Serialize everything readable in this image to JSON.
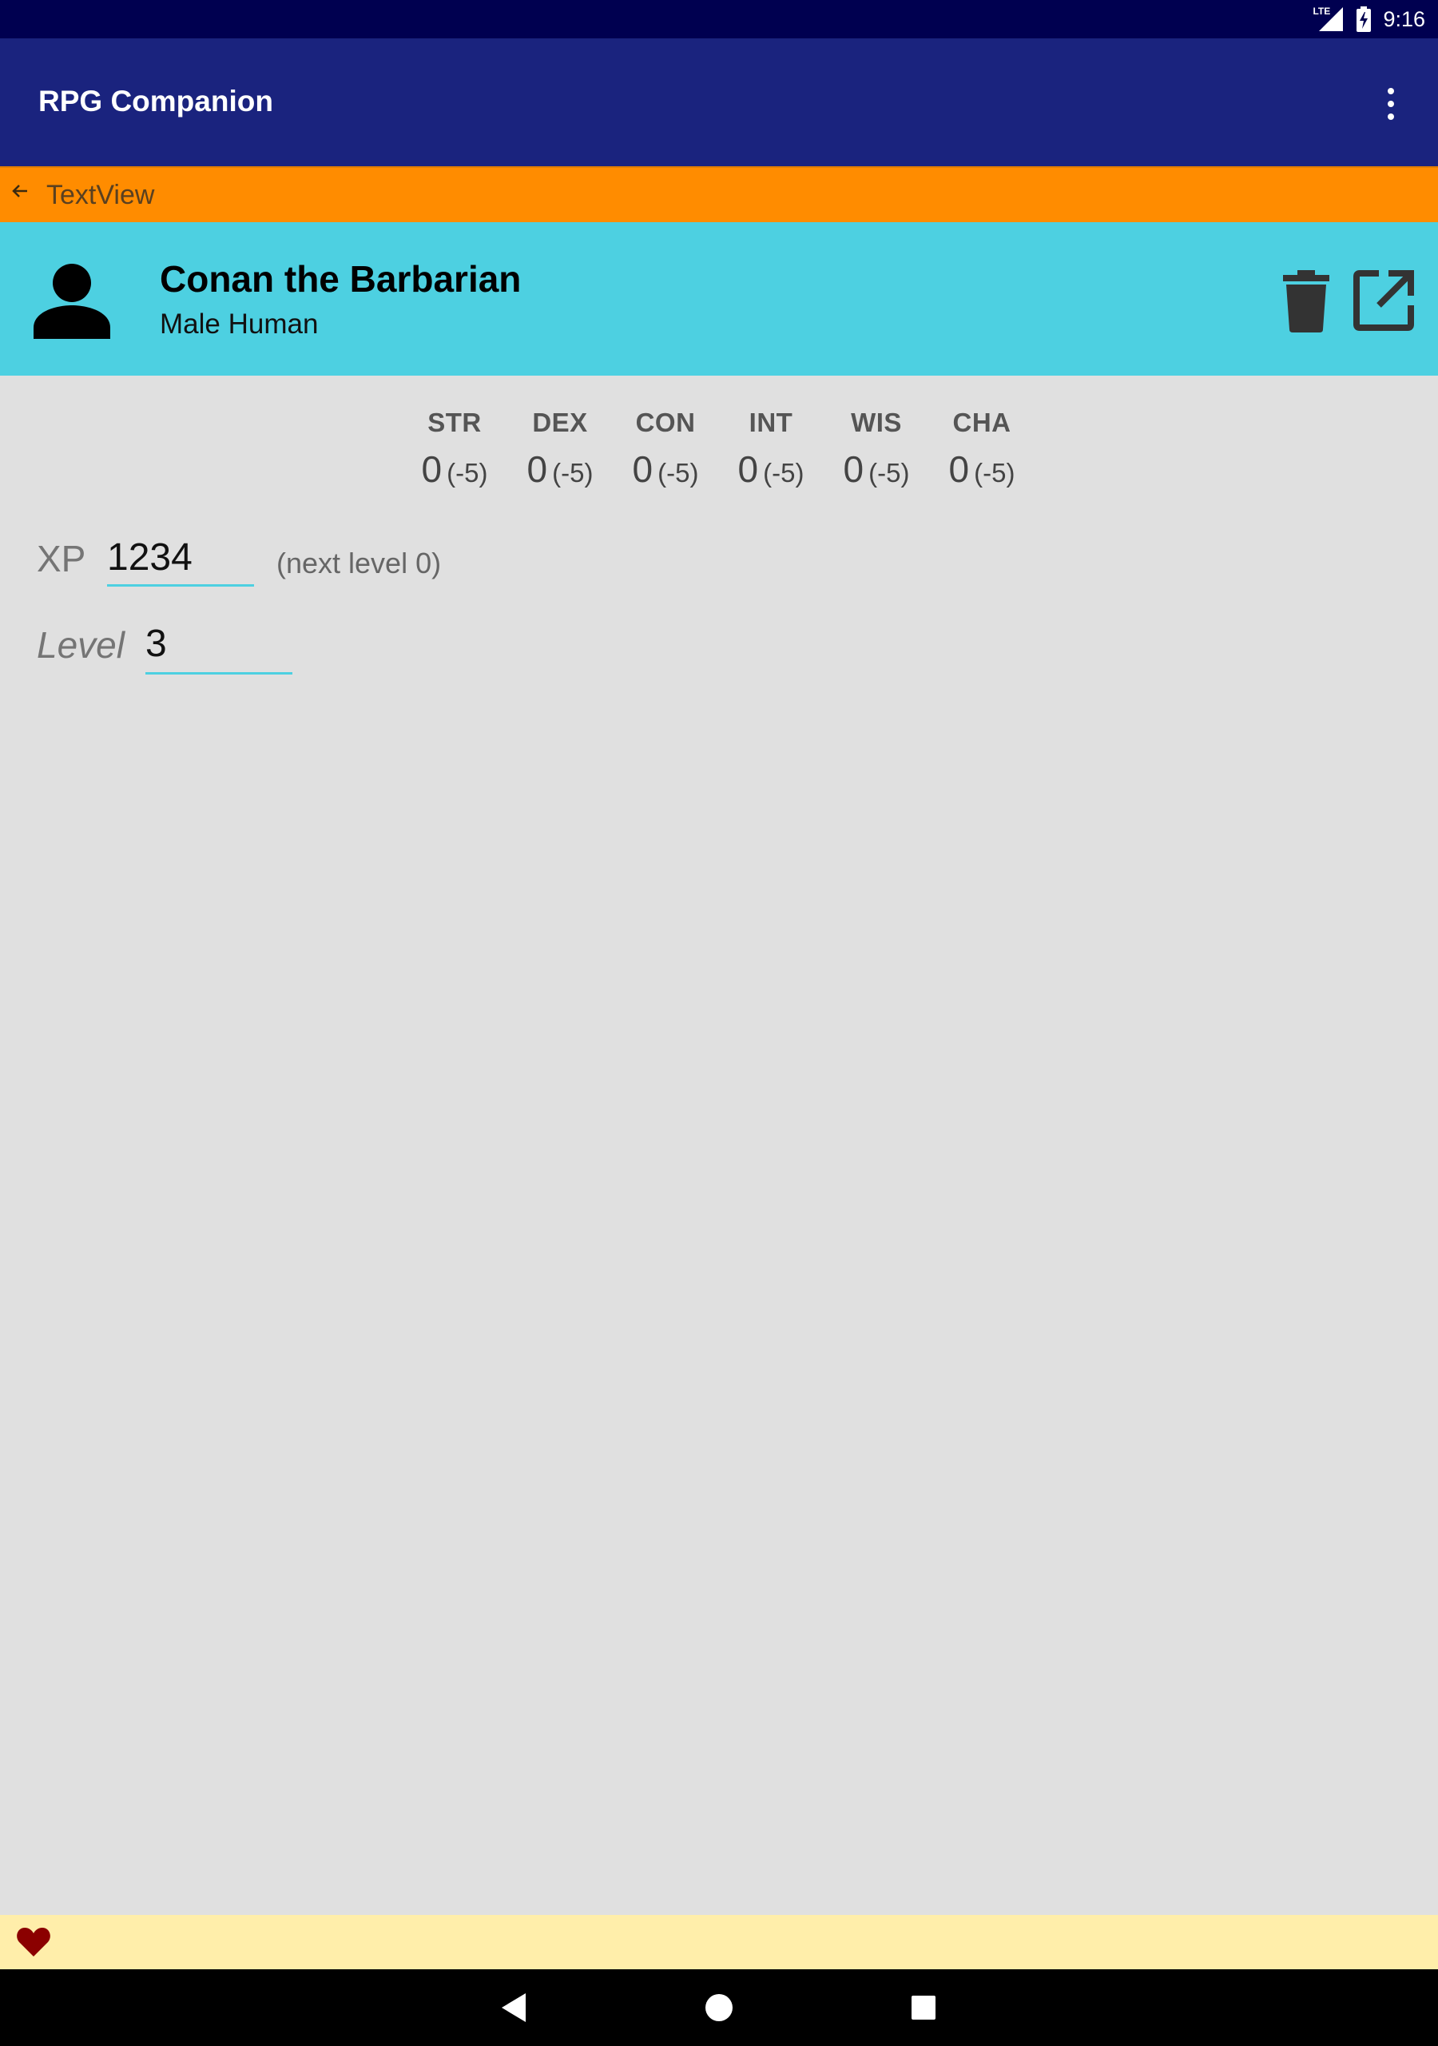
{
  "status_bar": {
    "network_label": "LTE",
    "time": "9:16",
    "icons": [
      "lte-signal-icon",
      "battery-charging-icon"
    ]
  },
  "app_bar": {
    "title": "RPG Companion",
    "overflow_icon": "more-vert-icon"
  },
  "nav_bar": {
    "back_icon": "arrow-back-icon",
    "label": "TextView"
  },
  "character": {
    "name": "Conan the Barbarian",
    "subtitle": "Male Human",
    "avatar_icon": "person-icon",
    "actions": [
      {
        "name": "delete",
        "icon": "trash-icon"
      },
      {
        "name": "open-external",
        "icon": "open-in-new-icon"
      }
    ]
  },
  "stats": [
    {
      "label": "STR",
      "value": "0",
      "modifier": "(-5)"
    },
    {
      "label": "DEX",
      "value": "0",
      "modifier": "(-5)"
    },
    {
      "label": "CON",
      "value": "0",
      "modifier": "(-5)"
    },
    {
      "label": "INT",
      "value": "0",
      "modifier": "(-5)"
    },
    {
      "label": "WIS",
      "value": "0",
      "modifier": "(-5)"
    },
    {
      "label": "CHA",
      "value": "0",
      "modifier": "(-5)"
    }
  ],
  "xp": {
    "label": "XP",
    "value": "1234",
    "next_level": "(next level 0)"
  },
  "level": {
    "label": "Level",
    "value": "3"
  },
  "banner": {
    "icon": "heart-icon"
  },
  "system_nav": {
    "back_icon": "nav-back-icon",
    "home_icon": "nav-home-icon",
    "recents_icon": "nav-recents-icon"
  },
  "colors": {
    "status_bar": "#000050",
    "app_bar": "#1a237e",
    "nav_bar": "#ff8c00",
    "header": "#4dd0e1",
    "background": "#e0e0e0",
    "banner": "#ffeeaa",
    "heart": "#8b0000"
  }
}
